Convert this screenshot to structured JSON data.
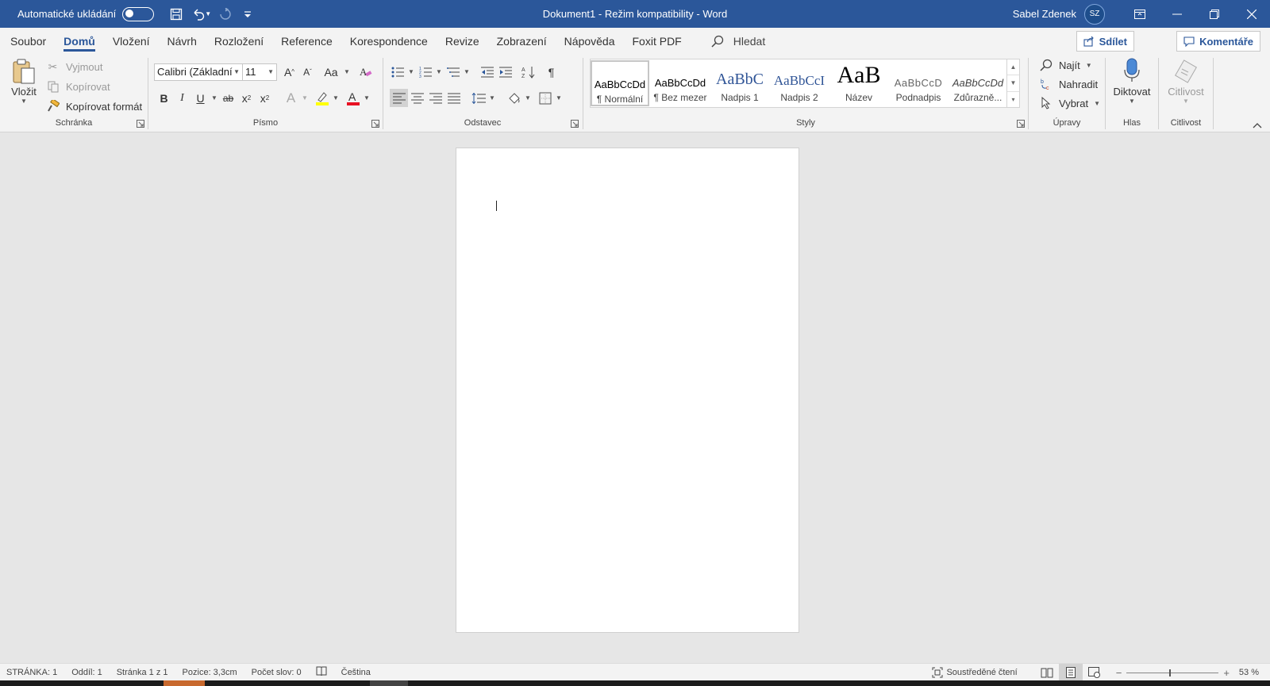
{
  "titlebar": {
    "autosave_label": "Automatické ukládání",
    "title": "Dokument1  -  Režim kompatibility  -  Word",
    "user_name": "Sabel Zdenek",
    "user_initials": "SZ"
  },
  "menu": {
    "tabs": [
      "Soubor",
      "Domů",
      "Vložení",
      "Návrh",
      "Rozložení",
      "Reference",
      "Korespondence",
      "Revize",
      "Zobrazení",
      "Nápověda",
      "Foxit PDF"
    ],
    "active_tab": "Domů",
    "search_label": "Hledat",
    "share_label": "Sdílet",
    "comments_label": "Komentáře"
  },
  "clipboard": {
    "paste_label": "Vložit",
    "cut_label": "Vyjmout",
    "copy_label": "Kopírovat",
    "format_painter_label": "Kopírovat formát",
    "group_label": "Schránka"
  },
  "font": {
    "font_name": "Calibri (Základní",
    "font_size": "11",
    "change_case": "Aa",
    "group_label": "Písmo"
  },
  "paragraph": {
    "group_label": "Odstavec"
  },
  "styles": {
    "items": [
      {
        "preview": "AaBbCcDd",
        "name": "¶ Normální"
      },
      {
        "preview": "AaBbCcDd",
        "name": "¶ Bez mezer"
      },
      {
        "preview": "AaBbC",
        "name": "Nadpis 1"
      },
      {
        "preview": "AaBbCcI",
        "name": "Nadpis 2"
      },
      {
        "preview": "AaB",
        "name": "Název"
      },
      {
        "preview": "AaBbCcD",
        "name": "Podnadpis"
      },
      {
        "preview": "AaBbCcDd",
        "name": "Zdůrazně..."
      }
    ],
    "group_label": "Styly"
  },
  "editing": {
    "find_label": "Najít",
    "replace_label": "Nahradit",
    "select_label": "Vybrat",
    "group_label": "Úpravy"
  },
  "voice": {
    "dictate_label": "Diktovat",
    "group_label": "Hlas"
  },
  "sensitivity": {
    "label": "Citlivost",
    "group_label": "Citlivost"
  },
  "statusbar": {
    "page": "STRÁNKA: 1",
    "section": "Oddíl: 1",
    "page_of": "Stránka 1 z 1",
    "position": "Pozice: 3,3cm",
    "word_count": "Počet slov: 0",
    "language": "Čeština",
    "focus_label": "Soustředěné čtení",
    "zoom_minus": "−",
    "zoom_plus": "+",
    "zoom": "53 %"
  },
  "colors": {
    "brand": "#2b579a",
    "highlight": "#ffff00",
    "font_color": "#e81123"
  }
}
